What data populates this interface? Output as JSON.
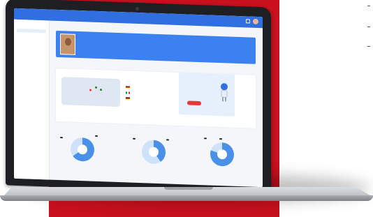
{
  "colors": {
    "background_red": "#c8101e",
    "app_primary": "#2f6fe0",
    "profile_card": "#3b82f0",
    "donut_fill": "#4a90e8",
    "donut_light": "#cfe2fb",
    "promo_button": "#e53935"
  },
  "icons": [
    "laptop-icon",
    "search-icon",
    "bell-icon",
    "robot-icon",
    "map-pin-icon"
  ]
}
